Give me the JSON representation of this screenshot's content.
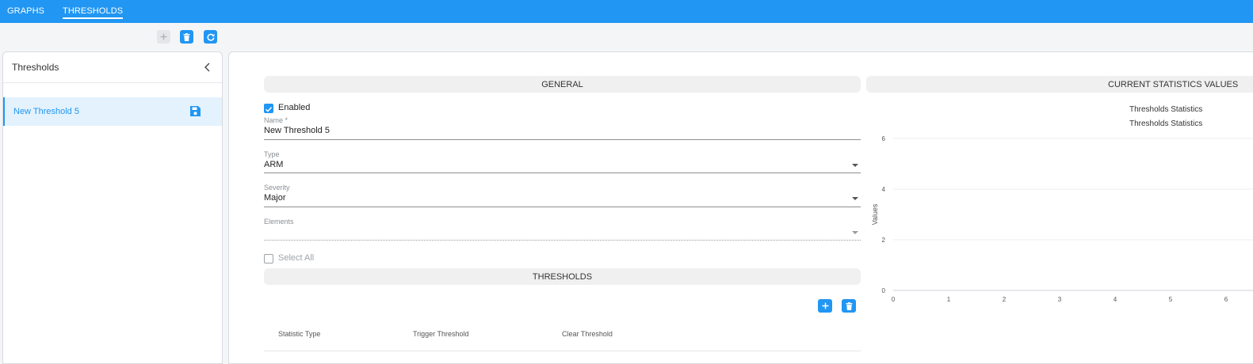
{
  "nav": {
    "tabs": [
      {
        "label": "GRAPHS",
        "active": false
      },
      {
        "label": "THRESHOLDS",
        "active": true
      }
    ]
  },
  "toolbar": {
    "add_icon": "plus-icon",
    "delete_icon": "trash-icon",
    "refresh_icon": "refresh-icon"
  },
  "sidebar": {
    "title": "Thresholds",
    "items": [
      {
        "label": "New Threshold 5",
        "icon": "save-icon",
        "selected": true
      }
    ]
  },
  "general": {
    "header": "GENERAL",
    "enabled_label": "Enabled",
    "enabled": true,
    "name_label": "Name *",
    "name_value": "New Threshold 5",
    "type_label": "Type",
    "type_value": "ARM",
    "severity_label": "Severity",
    "severity_value": "Major",
    "elements_label": "Elements",
    "elements_value": "",
    "select_all_label": "Select All",
    "select_all": false
  },
  "thresholds": {
    "header": "THRESHOLDS",
    "columns": [
      "Statistic Type",
      "Trigger Threshold",
      "Clear Threshold"
    ],
    "rows": []
  },
  "stats": {
    "header": "CURRENT STATISTICS VALUES"
  },
  "colors": {
    "accent": "#2196f3",
    "selected_bg": "#e3f2fd"
  },
  "chart_data": {
    "type": "line",
    "title": "Thresholds Statistics",
    "subtitle": "Thresholds Statistics",
    "xlabel": "",
    "ylabel": "Values",
    "x_ticks": [
      "0",
      "1",
      "2",
      "3",
      "4",
      "5",
      "6"
    ],
    "y_ticks": [
      "0",
      "2",
      "4",
      "6"
    ],
    "xlim": [
      0,
      6
    ],
    "ylim": [
      0,
      6
    ],
    "grid": true,
    "series": []
  }
}
